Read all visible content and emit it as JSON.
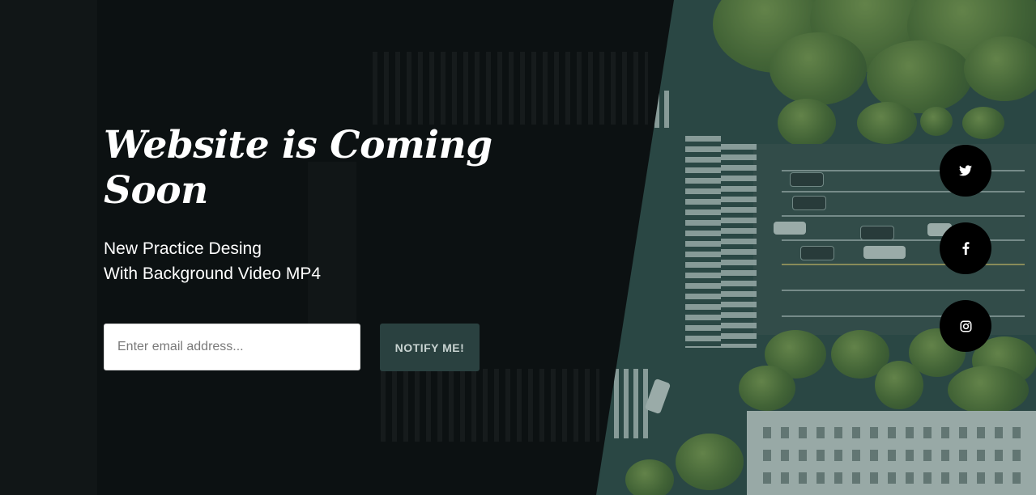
{
  "hero": {
    "title": "Website is Coming Soon",
    "subtitle_line1": "New Practice Desing",
    "subtitle_line2": "With Background Video MP4"
  },
  "subscribe": {
    "email_placeholder": "Enter email address...",
    "email_value": "",
    "button_label": "NOTIFY ME!"
  },
  "social": [
    {
      "name": "twitter",
      "icon": "twitter-icon"
    },
    {
      "name": "facebook",
      "icon": "facebook-icon"
    },
    {
      "name": "instagram",
      "icon": "instagram-icon"
    }
  ],
  "colors": {
    "overlay": "#0c1112",
    "button_bg": "#2a4140",
    "button_text": "#c8d3d1",
    "social_bg": "#000000",
    "scene_tint": "#2e4744"
  }
}
